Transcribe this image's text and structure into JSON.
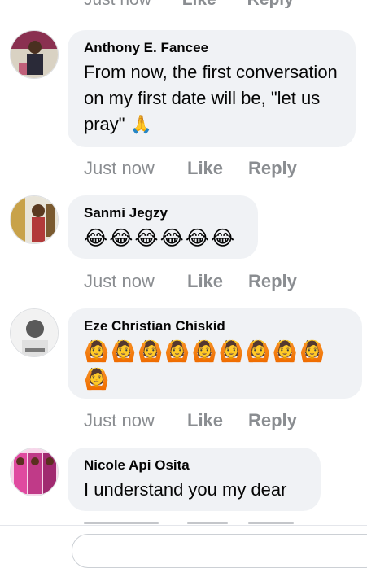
{
  "top_partial": {
    "time": "Just now",
    "like": "Like",
    "reply": "Reply"
  },
  "comments": [
    {
      "author": "Anthony E. Fancee",
      "text": "From now, the first conversation on my first date will be, \"let us pray\" 🙏",
      "actions": {
        "time": "Just now",
        "like": "Like",
        "reply": "Reply"
      },
      "avatar_colors": [
        "#3a3a4a",
        "#c0607a",
        "#d9d2c3"
      ]
    },
    {
      "author": "Sanmi Jegzy",
      "text": "😂😂😂😂😂😂",
      "actions": {
        "time": "Just now",
        "like": "Like",
        "reply": "Reply"
      },
      "avatar_colors": [
        "#c8a24a",
        "#e8e4d8",
        "#7a5a30"
      ]
    },
    {
      "author": "Eze Christian Chiskid",
      "text": "🙆🙆🙆🙆🙆🙆🙆🙆🙆🙆",
      "actions": {
        "time": "Just now",
        "like": "Like",
        "reply": "Reply"
      },
      "avatar_colors": [
        "#e0e0e0",
        "#5a5a5a",
        "#ffffff"
      ]
    },
    {
      "author": "Nicole Api Osita",
      "text": "I understand you my dear",
      "avatar_colors": [
        "#e04aa0",
        "#ffffff",
        "#a02a70"
      ]
    }
  ]
}
